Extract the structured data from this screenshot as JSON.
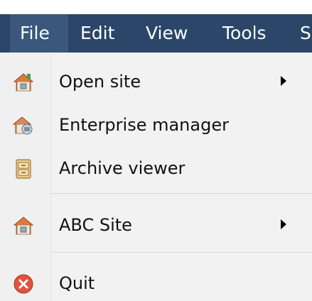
{
  "menubar": {
    "items": [
      {
        "label": "File",
        "active": true
      },
      {
        "label": "Edit"
      },
      {
        "label": "View"
      },
      {
        "label": "Tools"
      },
      {
        "label": "S"
      }
    ],
    "background": "#2b4668",
    "active_background": "#39587c"
  },
  "file_menu": {
    "items": [
      {
        "label": "Open site",
        "icon": "house-icon",
        "has_submenu": true
      },
      {
        "label": "Enterprise manager",
        "icon": "enterprise-icon",
        "has_submenu": false
      },
      {
        "label": "Archive viewer",
        "icon": "archive-icon",
        "has_submenu": false
      },
      {
        "label": "ABC Site",
        "icon": "house-icon",
        "has_submenu": true
      },
      {
        "label": "Quit",
        "icon": "quit-icon",
        "has_submenu": false
      }
    ]
  }
}
